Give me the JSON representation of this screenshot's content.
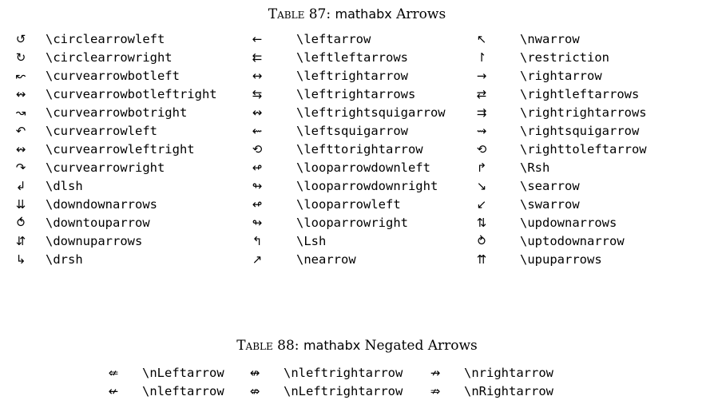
{
  "table87": {
    "caption_label": "Table 87:",
    "caption_pkg": "mathabx",
    "caption_rest": "Arrows",
    "columns": [
      [
        {
          "sym": "↺",
          "cmd": "\\circlearrowleft"
        },
        {
          "sym": "↻",
          "cmd": "\\circlearrowright"
        },
        {
          "sym": "↜",
          "cmd": "\\curvearrowbotleft"
        },
        {
          "sym": "↭",
          "cmd": "\\curvearrowbotleftright"
        },
        {
          "sym": "↝",
          "cmd": "\\curvearrowbotright"
        },
        {
          "sym": "↶",
          "cmd": "\\curvearrowleft"
        },
        {
          "sym": "↭",
          "cmd": "\\curvearrowleftright"
        },
        {
          "sym": "↷",
          "cmd": "\\curvearrowright"
        },
        {
          "sym": "↲",
          "cmd": "\\dlsh"
        },
        {
          "sym": "⇊",
          "cmd": "\\downdownarrows"
        },
        {
          "sym": "⥀",
          "cmd": "\\downtouparrow"
        },
        {
          "sym": "⇵",
          "cmd": "\\downuparrows"
        },
        {
          "sym": "↳",
          "cmd": "\\drsh"
        }
      ],
      [
        {
          "sym": "←",
          "cmd": "\\leftarrow"
        },
        {
          "sym": "⇇",
          "cmd": "\\leftleftarrows"
        },
        {
          "sym": "↔",
          "cmd": "\\leftrightarrow"
        },
        {
          "sym": "⇆",
          "cmd": "\\leftrightarrows"
        },
        {
          "sym": "↭",
          "cmd": "\\leftrightsquigarrow"
        },
        {
          "sym": "⇜",
          "cmd": "\\leftsquigarrow"
        },
        {
          "sym": "⟲",
          "cmd": "\\lefttorightarrow"
        },
        {
          "sym": "↫",
          "cmd": "\\looparrowdownleft"
        },
        {
          "sym": "↬",
          "cmd": "\\looparrowdownright"
        },
        {
          "sym": "↫",
          "cmd": "\\looparrowleft"
        },
        {
          "sym": "↬",
          "cmd": "\\looparrowright"
        },
        {
          "sym": "↰",
          "cmd": "\\Lsh"
        },
        {
          "sym": "↗",
          "cmd": "\\nearrow"
        }
      ],
      [
        {
          "sym": "↖",
          "cmd": "\\nwarrow"
        },
        {
          "sym": "↾",
          "cmd": "\\restriction"
        },
        {
          "sym": "→",
          "cmd": "\\rightarrow"
        },
        {
          "sym": "⇄",
          "cmd": "\\rightleftarrows"
        },
        {
          "sym": "⇉",
          "cmd": "\\rightrightarrows"
        },
        {
          "sym": "⇝",
          "cmd": "\\rightsquigarrow"
        },
        {
          "sym": "⟲",
          "cmd": "\\righttoleftarrow"
        },
        {
          "sym": "↱",
          "cmd": "\\Rsh"
        },
        {
          "sym": "↘",
          "cmd": "\\searrow"
        },
        {
          "sym": "↙",
          "cmd": "\\swarrow"
        },
        {
          "sym": "⇅",
          "cmd": "\\updownarrows"
        },
        {
          "sym": "⥁",
          "cmd": "\\uptodownarrow"
        },
        {
          "sym": "⇈",
          "cmd": "\\upuparrows"
        }
      ]
    ]
  },
  "table88": {
    "caption_label": "Table 88:",
    "caption_pkg": "mathabx",
    "caption_rest": "Negated Arrows",
    "rows": [
      [
        {
          "sym": "⇍",
          "cmd": "\\nLeftarrow"
        },
        {
          "sym": "↮",
          "cmd": "\\nleftrightarrow"
        },
        {
          "sym": "↛",
          "cmd": "\\nrightarrow"
        }
      ],
      [
        {
          "sym": "↚",
          "cmd": "\\nleftarrow"
        },
        {
          "sym": "⇎",
          "cmd": "\\nLeftrightarrow"
        },
        {
          "sym": "⇏",
          "cmd": "\\nRightarrow"
        }
      ]
    ]
  }
}
